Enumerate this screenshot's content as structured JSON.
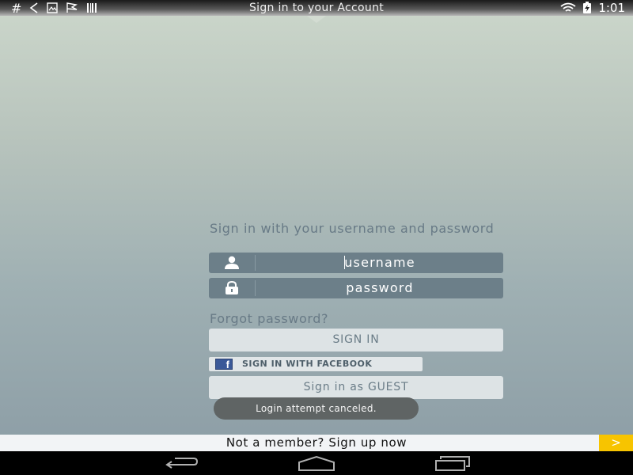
{
  "status_bar": {
    "title": "Sign in to your Account",
    "left_icons": [
      "hash-icon",
      "back-icon",
      "image-icon",
      "flag-icon",
      "barcode-icon"
    ],
    "hash_text": "#",
    "time": "1:01"
  },
  "login": {
    "prompt": "Sign in with your username and password",
    "username_placeholder": "username",
    "password_placeholder": "password",
    "forgot_label": "Forgot password?",
    "signin_label": "SIGN IN",
    "facebook_label": "SIGN IN WITH FACEBOOK",
    "facebook_glyph": "f",
    "guest_label": "Sign in as GUEST"
  },
  "toast": {
    "message": "Login attempt canceled."
  },
  "banner": {
    "text": "Not a member? Sign up now",
    "arrow": ">"
  },
  "colors": {
    "field_bg": "#6c7f89",
    "button_bg": "#dde3e5",
    "facebook_blue": "#3b5998",
    "banner_arrow": "#f7c400"
  }
}
